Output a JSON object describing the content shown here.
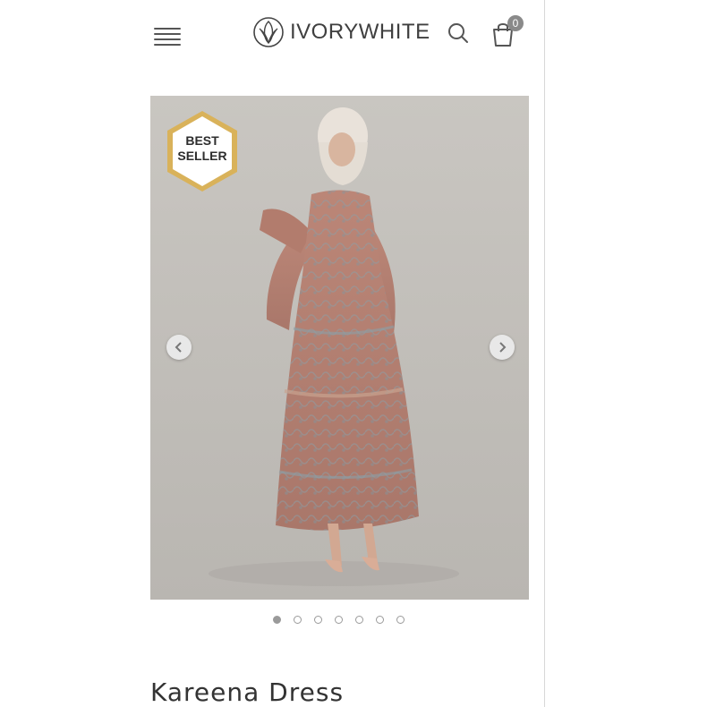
{
  "header": {
    "brand_name": "IVORYWHITE",
    "cart_count": "0",
    "icons": [
      "menu-icon",
      "search-icon",
      "shopping-bag-icon"
    ]
  },
  "product": {
    "badge_line1": "BEST",
    "badge_line2": "SELLER",
    "title": "Kareena Dress",
    "image_count": 7,
    "active_image": 1
  },
  "colors": {
    "dress": "#b5806f",
    "background": "#cbc7c2",
    "badge_border": "#d9b25a"
  }
}
